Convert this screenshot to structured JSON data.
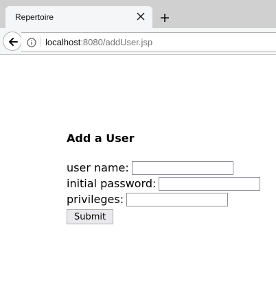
{
  "browser": {
    "tab_title": "Repertoire",
    "url_host": "localhost",
    "url_rest": ":8080/addUser.jsp"
  },
  "icons": {
    "tab_close": "close-icon",
    "new_tab": "plus-icon",
    "back": "back-arrow-icon",
    "info": "info-icon"
  },
  "form": {
    "heading": "Add a User",
    "username_label": "user name:",
    "username_value": "",
    "password_label": "initial password:",
    "password_value": "",
    "privileges_label": "privileges:",
    "privileges_value": "",
    "submit_label": "Submit"
  }
}
